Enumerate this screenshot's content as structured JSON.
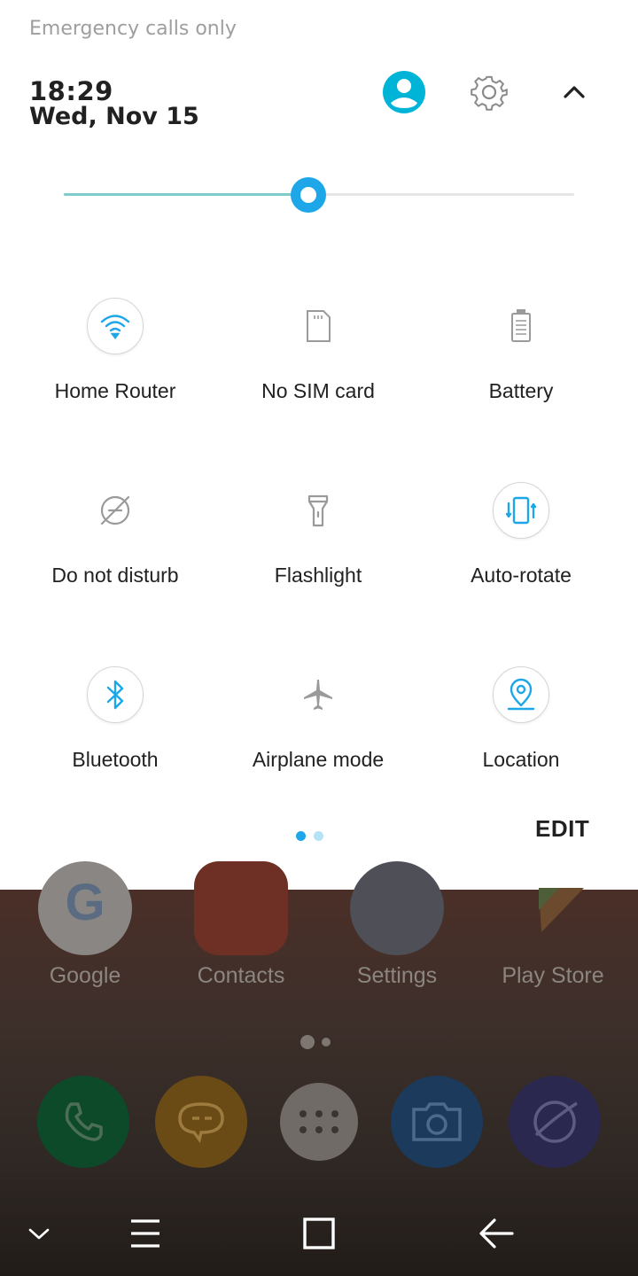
{
  "status_bar": {
    "carrier_text": "Emergency calls only"
  },
  "header": {
    "time": "18:29",
    "date": "Wed, Nov 15"
  },
  "brightness": {
    "level": 0.48
  },
  "tiles": [
    {
      "label": "Home Router",
      "icon": "wifi-icon",
      "active": true
    },
    {
      "label": "No SIM card",
      "icon": "sim-card-icon",
      "active": false
    },
    {
      "label": "Battery",
      "icon": "battery-icon",
      "active": false
    },
    {
      "label": "Do not disturb",
      "icon": "do-not-disturb-icon",
      "active": false
    },
    {
      "label": "Flashlight",
      "icon": "flashlight-icon",
      "active": false
    },
    {
      "label": "Auto-rotate",
      "icon": "auto-rotate-icon",
      "active": true
    },
    {
      "label": "Bluetooth",
      "icon": "bluetooth-icon",
      "active": true
    },
    {
      "label": "Airplane mode",
      "icon": "airplane-icon",
      "active": false
    },
    {
      "label": "Location",
      "icon": "location-icon",
      "active": true
    }
  ],
  "pager": {
    "pages": 2,
    "current": 1
  },
  "edit_label": "EDIT",
  "home_apps": [
    {
      "label": "Google"
    },
    {
      "label": "Contacts"
    },
    {
      "label": "Settings"
    },
    {
      "label": "Play Store"
    }
  ],
  "colors": {
    "accent": "#1ea7e8",
    "slider_fill": "#7dcbcb",
    "avatar": "#00b4d8",
    "panel_bg": "#ffffff"
  }
}
